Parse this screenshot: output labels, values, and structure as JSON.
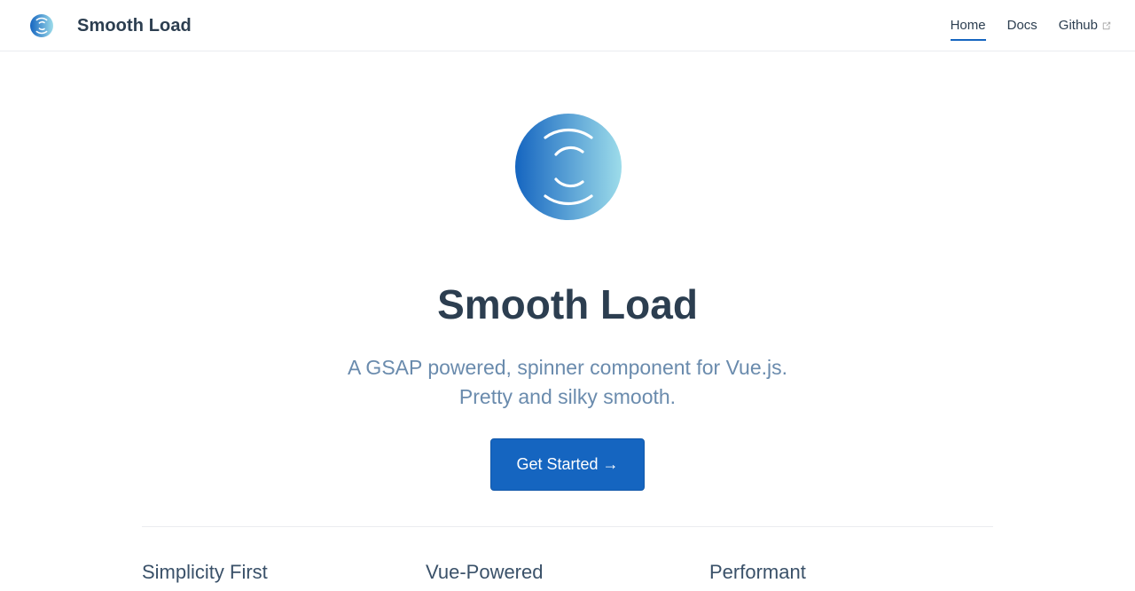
{
  "navbar": {
    "brand_title": "Smooth Load",
    "links": [
      {
        "label": "Home",
        "active": true
      },
      {
        "label": "Docs",
        "active": false
      },
      {
        "label": "Github",
        "active": false,
        "external": true
      }
    ]
  },
  "hero": {
    "title": "Smooth Load",
    "description_line1": "A GSAP powered, spinner component for Vue.js.",
    "description_line2": "Pretty and silky smooth.",
    "cta_label": "Get Started →"
  },
  "features": [
    {
      "title": "Simplicity First"
    },
    {
      "title": "Vue-Powered"
    },
    {
      "title": "Performant"
    }
  ],
  "colors": {
    "accent": "#1565c0",
    "text": "#2c3e50",
    "description": "#6a8bad",
    "border": "#eaecef",
    "logo_gradient_start": "#1565c0",
    "logo_gradient_end": "#9ddcea"
  }
}
